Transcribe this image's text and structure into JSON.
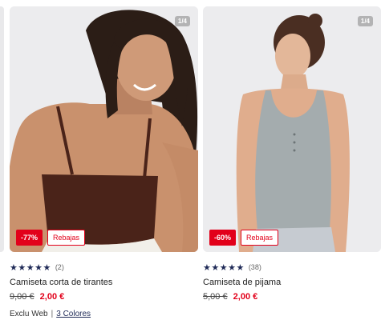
{
  "products": [
    {
      "image_counter": "1/4",
      "discount": "-77%",
      "sale_label": "Rebajas",
      "stars": "★★★★★",
      "rating_count": "(2)",
      "title": "Camiseta corta de tirantes",
      "old_price": "9,00 €",
      "new_price": "2,00 €",
      "exclusive": "Exclu Web",
      "separator": "|",
      "colors": "3 Colores"
    },
    {
      "image_counter": "1/4",
      "discount": "-60%",
      "sale_label": "Rebajas",
      "stars": "★★★★★",
      "rating_count": "(38)",
      "title": "Camiseta de pijama",
      "old_price": "5,00 €",
      "new_price": "2,00 €"
    }
  ],
  "colors": {
    "accent_red": "#e2001a",
    "star_navy": "#1f2a57",
    "card_bg": "#ebebed"
  }
}
